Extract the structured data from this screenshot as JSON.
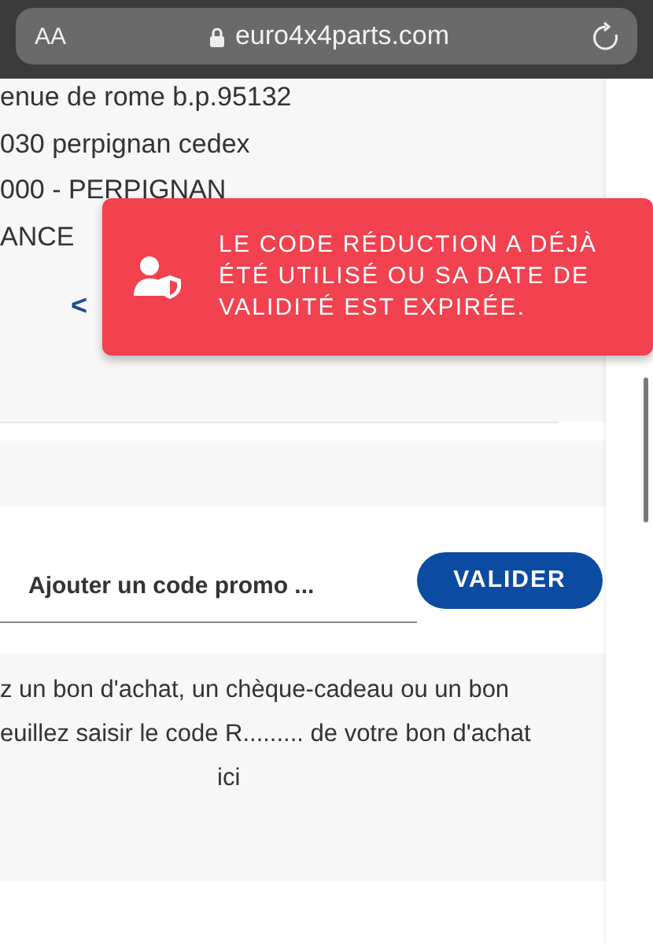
{
  "browser": {
    "text_size_button": "AA",
    "url": "euro4x4parts.com"
  },
  "address_lines": [
    "enue de rome b.p.95132",
    "030 perpignan cedex",
    "000 - PERPIGNAN",
    "ANCE"
  ],
  "carousel": {
    "prev": "<"
  },
  "toast": {
    "message": "LE CODE RÉDUCTION A DÉJÀ ÉTÉ UTILISÉ OU SA DATE DE VALIDITÉ EST EXPIRÉE."
  },
  "promo": {
    "placeholder": "Ajouter un code promo ...",
    "button": "VALIDER"
  },
  "voucher_text": [
    "z un bon d'achat, un chèque-cadeau ou un bon",
    "euillez saisir le code R......... de votre bon d'achat",
    "ici"
  ]
}
